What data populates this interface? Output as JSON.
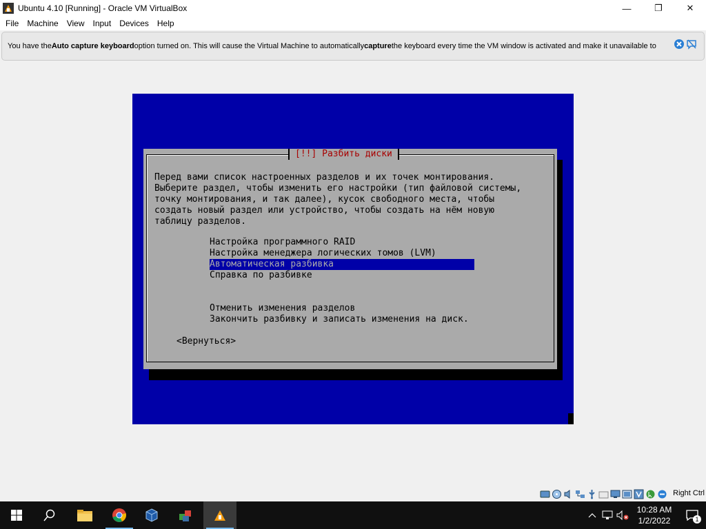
{
  "window": {
    "title": "Ubuntu 4.10 [Running] - Oracle VM VirtualBox",
    "minimize": "—",
    "maximize": "❐",
    "close": "✕"
  },
  "menu": {
    "items": [
      "File",
      "Machine",
      "View",
      "Input",
      "Devices",
      "Help"
    ]
  },
  "notice": {
    "t1": "You have the ",
    "b1": "Auto capture keyboard",
    "t2": " option turned on. This will cause the Virtual Machine to automatically ",
    "b2": "capture",
    "t3": " the keyboard every time the VM window is activated and make it unavailable to"
  },
  "installer": {
    "title": "[!!] Разбить диски",
    "description": "Перед вами список настроенных разделов и их точек монтирования.\nВыберите раздел, чтобы изменить его настройки (тип файловой системы,\nточку монтирования, и так далее), кусок свободного места, чтобы\nсоздать новый раздел или устройство, чтобы создать на нём новую\nтаблицу разделов.",
    "options": [
      "Настройка программного RAID",
      "Настройка менеджера логических томов (LVM)",
      "Автоматическая разбивка",
      "Справка по разбивке",
      "Отменить изменения разделов",
      "Закончить разбивку и записать изменения на диск."
    ],
    "selected_index": 2,
    "back_button": "<Вернуться>"
  },
  "statusbar": {
    "host_key": "Right Ctrl"
  },
  "taskbar": {
    "time": "10:28 AM",
    "date": "1/2/2022",
    "notification_count": "1"
  }
}
